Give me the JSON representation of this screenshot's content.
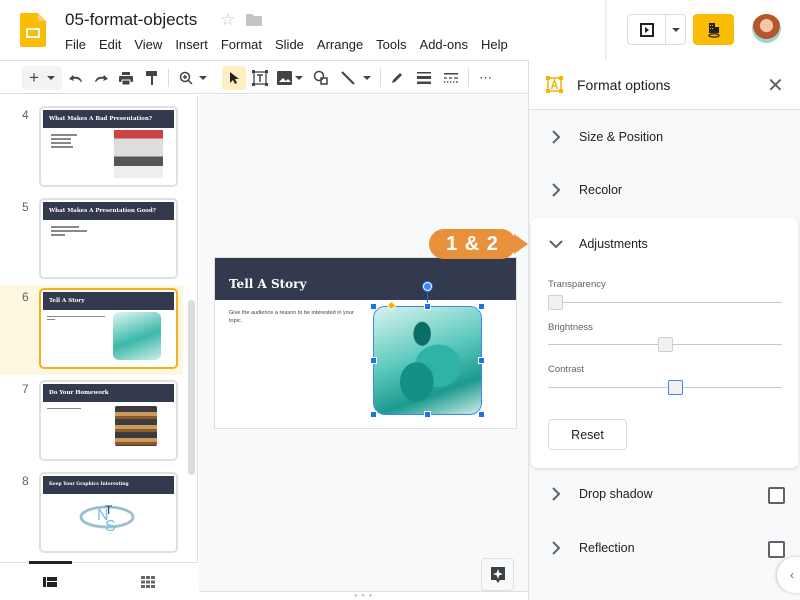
{
  "app": {
    "doc_title": "05-format-objects",
    "menu": [
      "File",
      "Edit",
      "View",
      "Insert",
      "Format",
      "Slide",
      "Arrange",
      "Tools",
      "Add-ons",
      "Help"
    ],
    "brand_color": "#fbbc04"
  },
  "toolbar": {
    "icons": [
      "new-slide-icon",
      "undo-icon",
      "redo-icon",
      "print-icon",
      "paint-format-icon",
      "zoom-icon",
      "select-icon",
      "text-box-icon",
      "image-icon",
      "shape-icon",
      "line-icon",
      "border-color-icon",
      "border-weight-icon",
      "border-dash-icon",
      "more-icon"
    ],
    "active_tool": "select"
  },
  "filmstrip": {
    "slides": [
      {
        "number": "4",
        "title": "What Makes A Bad Presentation?",
        "picture": "audience-photo"
      },
      {
        "number": "5",
        "title": "What Makes A Presentation Good?",
        "picture": ""
      },
      {
        "number": "6",
        "title": "Tell A Story",
        "picture": "mother-child-reading",
        "selected": true
      },
      {
        "number": "7",
        "title": "Do Your Homework",
        "picture": "book-stack"
      },
      {
        "number": "8",
        "title": "Keep Your Graphics Interesting",
        "picture": "nts-logo"
      }
    ],
    "view_tabs": [
      "filmstrip-view",
      "grid-view"
    ]
  },
  "slide": {
    "title": "Tell A Story",
    "body": "Give the audience a reason to be interested in your topic."
  },
  "callout": {
    "label": "1 & 2",
    "color": "#e8913a"
  },
  "format_panel": {
    "title": "Format options",
    "sections": {
      "size_position": "Size & Position",
      "recolor": "Recolor",
      "adjustments": "Adjustments",
      "drop_shadow": "Drop shadow",
      "reflection": "Reflection"
    },
    "adjustments": {
      "transparency_label": "Transparency",
      "transparency_value": 0,
      "brightness_label": "Brightness",
      "brightness_value": 0.5,
      "contrast_label": "Contrast",
      "contrast_value": 0.55,
      "reset_label": "Reset"
    },
    "drop_shadow_checked": false,
    "reflection_checked": false
  }
}
